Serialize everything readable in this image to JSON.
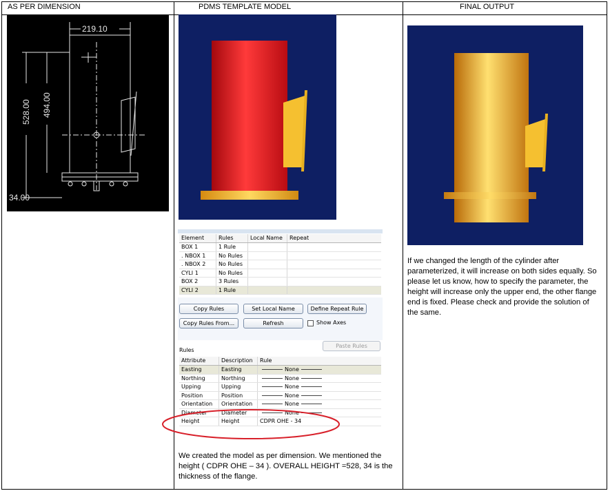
{
  "headers": {
    "col1": "AS PER DIMENSION",
    "col2": "PDMS TEMPLATE MODEL",
    "col3": "FINAL OUTPUT"
  },
  "drawing": {
    "dim_width": "219.10",
    "dim_height_outer": "528.00",
    "dim_height_inner": "494.00",
    "dim_flange": "34.00"
  },
  "dialog": {
    "element_columns": [
      "Element",
      "Rules",
      "Local Name",
      "Repeat"
    ],
    "elements": [
      {
        "element": "BOX  1",
        "rules": "1 Rule"
      },
      {
        "element": ". NBOX  1",
        "rules": "No Rules"
      },
      {
        "element": ". NBOX  2",
        "rules": "No Rules"
      },
      {
        "element": "CYLI  1",
        "rules": "No Rules"
      },
      {
        "element": "BOX  2",
        "rules": "3 Rules"
      },
      {
        "element": "CYLI  2",
        "rules": "1 Rule"
      }
    ],
    "buttons": {
      "copy_rules": "Copy Rules",
      "set_local_name": "Set Local Name",
      "define_repeat_rule": "Define Repeat Rule",
      "copy_rules_from": "Copy Rules From...",
      "refresh": "Refresh",
      "show_axes": "Show Axes",
      "paste_rules": "Paste Rules"
    },
    "rules_label": "Rules",
    "rule_columns": [
      "Attribute",
      "Description",
      "Rule"
    ],
    "rules": [
      {
        "attribute": "Easting",
        "description": "Easting",
        "rule": "None"
      },
      {
        "attribute": "Northing",
        "description": "Northing",
        "rule": "None"
      },
      {
        "attribute": "Upping",
        "description": "Upping",
        "rule": "None"
      },
      {
        "attribute": "Position",
        "description": "Position",
        "rule": "None"
      },
      {
        "attribute": "Orientation",
        "description": "Orientation",
        "rule": "None"
      },
      {
        "attribute": "Diameter",
        "description": "Diameter",
        "rule": "None"
      },
      {
        "attribute": "Height",
        "description": "Height",
        "rule": "CDPR OHE - 34"
      }
    ]
  },
  "texts": {
    "template_note": "We created the model as per dimension. We mentioned the height ( CDPR OHE – 34 ). OVERALL HEIGHT =528, 34 is the thickness of the flange.",
    "output_note": "If we changed the length of the cylinder after parameterized, it will increase on both sides equally. So please let us know, how to specify the parameter, the height will increase only the upper end, the  other flange end is fixed. Please check and provide the solution of the same."
  },
  "colors": {
    "model_bg": "#0e1f63",
    "cylinder_red": "#e0141c",
    "flange_gold": "#f5c030",
    "annotation_red": "#d8202a"
  }
}
